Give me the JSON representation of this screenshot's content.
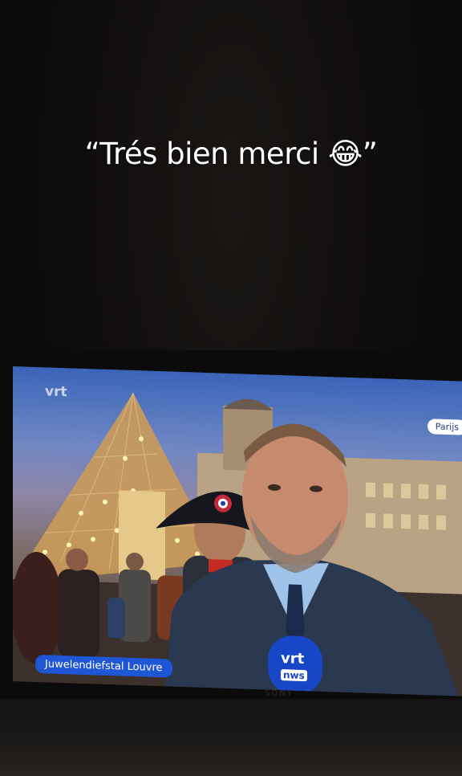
{
  "caption": {
    "text": "“Trés bien merci 😂”"
  },
  "broadcast": {
    "channel_logo": "vrt",
    "location_tag": "Parijs",
    "headline": "Juwelendiefstal Louvre",
    "microphone_logo_top": "vrt",
    "microphone_logo_bottom": "nws"
  },
  "tv": {
    "brand": "SONY"
  },
  "colors": {
    "sky": "#3a64b9",
    "headline_bg": "#1f56d6",
    "mic_blue": "#1747c7"
  }
}
